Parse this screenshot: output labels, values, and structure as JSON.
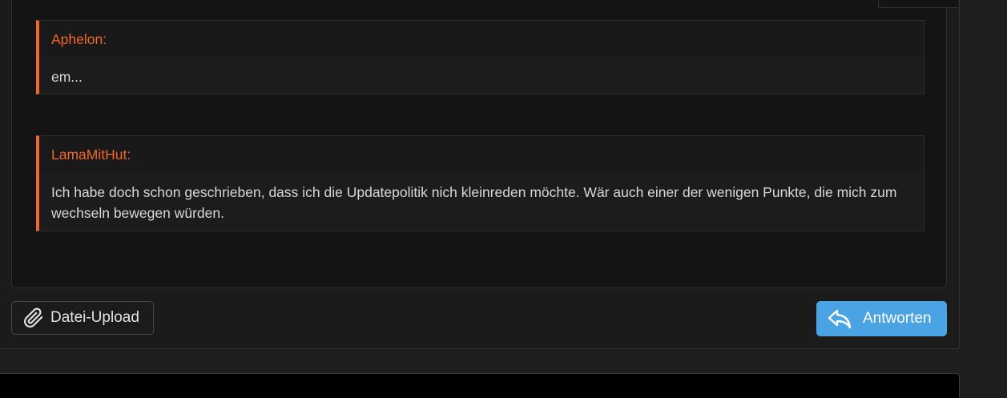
{
  "quotes": [
    {
      "author": "Aphelon:",
      "text": "em..."
    },
    {
      "author": "LamaMitHut:",
      "text": "Ich habe doch schon geschrieben, dass ich die Updatepolitik nich kleinreden möchte. Wär auch einer der wenigen Punkte, die mich zum wechseln bewegen würden."
    }
  ],
  "actions": {
    "upload_label": "Datei-Upload",
    "upload_icon": "paperclip-icon",
    "reply_label": "Antworten",
    "reply_icon": "reply-arrow-icon"
  },
  "colors": {
    "accent": "#f2672a",
    "primary_button": "#4aa3e2",
    "background": "#141414"
  }
}
